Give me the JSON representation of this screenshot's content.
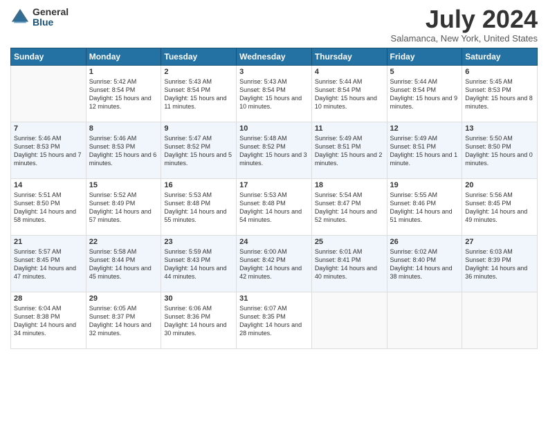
{
  "logo": {
    "general": "General",
    "blue": "Blue"
  },
  "title": "July 2024",
  "location": "Salamanca, New York, United States",
  "days_of_week": [
    "Sunday",
    "Monday",
    "Tuesday",
    "Wednesday",
    "Thursday",
    "Friday",
    "Saturday"
  ],
  "weeks": [
    [
      {
        "day": "",
        "sunrise": "",
        "sunset": "",
        "daylight": ""
      },
      {
        "day": "1",
        "sunrise": "Sunrise: 5:42 AM",
        "sunset": "Sunset: 8:54 PM",
        "daylight": "Daylight: 15 hours and 12 minutes."
      },
      {
        "day": "2",
        "sunrise": "Sunrise: 5:43 AM",
        "sunset": "Sunset: 8:54 PM",
        "daylight": "Daylight: 15 hours and 11 minutes."
      },
      {
        "day": "3",
        "sunrise": "Sunrise: 5:43 AM",
        "sunset": "Sunset: 8:54 PM",
        "daylight": "Daylight: 15 hours and 10 minutes."
      },
      {
        "day": "4",
        "sunrise": "Sunrise: 5:44 AM",
        "sunset": "Sunset: 8:54 PM",
        "daylight": "Daylight: 15 hours and 10 minutes."
      },
      {
        "day": "5",
        "sunrise": "Sunrise: 5:44 AM",
        "sunset": "Sunset: 8:54 PM",
        "daylight": "Daylight: 15 hours and 9 minutes."
      },
      {
        "day": "6",
        "sunrise": "Sunrise: 5:45 AM",
        "sunset": "Sunset: 8:53 PM",
        "daylight": "Daylight: 15 hours and 8 minutes."
      }
    ],
    [
      {
        "day": "7",
        "sunrise": "Sunrise: 5:46 AM",
        "sunset": "Sunset: 8:53 PM",
        "daylight": "Daylight: 15 hours and 7 minutes."
      },
      {
        "day": "8",
        "sunrise": "Sunrise: 5:46 AM",
        "sunset": "Sunset: 8:53 PM",
        "daylight": "Daylight: 15 hours and 6 minutes."
      },
      {
        "day": "9",
        "sunrise": "Sunrise: 5:47 AM",
        "sunset": "Sunset: 8:52 PM",
        "daylight": "Daylight: 15 hours and 5 minutes."
      },
      {
        "day": "10",
        "sunrise": "Sunrise: 5:48 AM",
        "sunset": "Sunset: 8:52 PM",
        "daylight": "Daylight: 15 hours and 3 minutes."
      },
      {
        "day": "11",
        "sunrise": "Sunrise: 5:49 AM",
        "sunset": "Sunset: 8:51 PM",
        "daylight": "Daylight: 15 hours and 2 minutes."
      },
      {
        "day": "12",
        "sunrise": "Sunrise: 5:49 AM",
        "sunset": "Sunset: 8:51 PM",
        "daylight": "Daylight: 15 hours and 1 minute."
      },
      {
        "day": "13",
        "sunrise": "Sunrise: 5:50 AM",
        "sunset": "Sunset: 8:50 PM",
        "daylight": "Daylight: 15 hours and 0 minutes."
      }
    ],
    [
      {
        "day": "14",
        "sunrise": "Sunrise: 5:51 AM",
        "sunset": "Sunset: 8:50 PM",
        "daylight": "Daylight: 14 hours and 58 minutes."
      },
      {
        "day": "15",
        "sunrise": "Sunrise: 5:52 AM",
        "sunset": "Sunset: 8:49 PM",
        "daylight": "Daylight: 14 hours and 57 minutes."
      },
      {
        "day": "16",
        "sunrise": "Sunrise: 5:53 AM",
        "sunset": "Sunset: 8:48 PM",
        "daylight": "Daylight: 14 hours and 55 minutes."
      },
      {
        "day": "17",
        "sunrise": "Sunrise: 5:53 AM",
        "sunset": "Sunset: 8:48 PM",
        "daylight": "Daylight: 14 hours and 54 minutes."
      },
      {
        "day": "18",
        "sunrise": "Sunrise: 5:54 AM",
        "sunset": "Sunset: 8:47 PM",
        "daylight": "Daylight: 14 hours and 52 minutes."
      },
      {
        "day": "19",
        "sunrise": "Sunrise: 5:55 AM",
        "sunset": "Sunset: 8:46 PM",
        "daylight": "Daylight: 14 hours and 51 minutes."
      },
      {
        "day": "20",
        "sunrise": "Sunrise: 5:56 AM",
        "sunset": "Sunset: 8:45 PM",
        "daylight": "Daylight: 14 hours and 49 minutes."
      }
    ],
    [
      {
        "day": "21",
        "sunrise": "Sunrise: 5:57 AM",
        "sunset": "Sunset: 8:45 PM",
        "daylight": "Daylight: 14 hours and 47 minutes."
      },
      {
        "day": "22",
        "sunrise": "Sunrise: 5:58 AM",
        "sunset": "Sunset: 8:44 PM",
        "daylight": "Daylight: 14 hours and 45 minutes."
      },
      {
        "day": "23",
        "sunrise": "Sunrise: 5:59 AM",
        "sunset": "Sunset: 8:43 PM",
        "daylight": "Daylight: 14 hours and 44 minutes."
      },
      {
        "day": "24",
        "sunrise": "Sunrise: 6:00 AM",
        "sunset": "Sunset: 8:42 PM",
        "daylight": "Daylight: 14 hours and 42 minutes."
      },
      {
        "day": "25",
        "sunrise": "Sunrise: 6:01 AM",
        "sunset": "Sunset: 8:41 PM",
        "daylight": "Daylight: 14 hours and 40 minutes."
      },
      {
        "day": "26",
        "sunrise": "Sunrise: 6:02 AM",
        "sunset": "Sunset: 8:40 PM",
        "daylight": "Daylight: 14 hours and 38 minutes."
      },
      {
        "day": "27",
        "sunrise": "Sunrise: 6:03 AM",
        "sunset": "Sunset: 8:39 PM",
        "daylight": "Daylight: 14 hours and 36 minutes."
      }
    ],
    [
      {
        "day": "28",
        "sunrise": "Sunrise: 6:04 AM",
        "sunset": "Sunset: 8:38 PM",
        "daylight": "Daylight: 14 hours and 34 minutes."
      },
      {
        "day": "29",
        "sunrise": "Sunrise: 6:05 AM",
        "sunset": "Sunset: 8:37 PM",
        "daylight": "Daylight: 14 hours and 32 minutes."
      },
      {
        "day": "30",
        "sunrise": "Sunrise: 6:06 AM",
        "sunset": "Sunset: 8:36 PM",
        "daylight": "Daylight: 14 hours and 30 minutes."
      },
      {
        "day": "31",
        "sunrise": "Sunrise: 6:07 AM",
        "sunset": "Sunset: 8:35 PM",
        "daylight": "Daylight: 14 hours and 28 minutes."
      },
      {
        "day": "",
        "sunrise": "",
        "sunset": "",
        "daylight": ""
      },
      {
        "day": "",
        "sunrise": "",
        "sunset": "",
        "daylight": ""
      },
      {
        "day": "",
        "sunrise": "",
        "sunset": "",
        "daylight": ""
      }
    ]
  ]
}
